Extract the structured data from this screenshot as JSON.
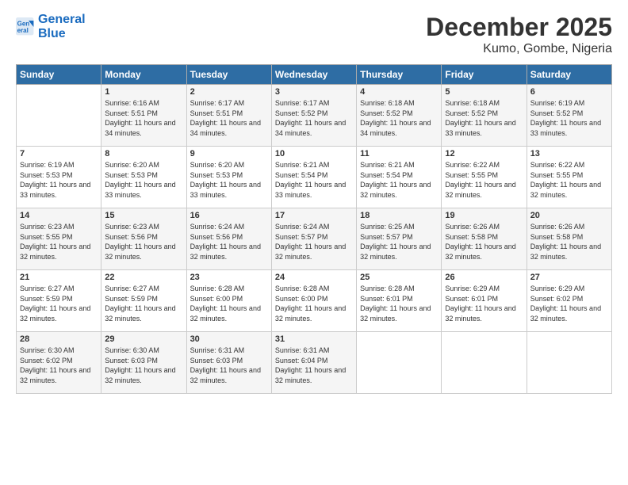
{
  "logo": {
    "line1": "General",
    "line2": "Blue"
  },
  "title": "December 2025",
  "location": "Kumo, Gombe, Nigeria",
  "weekdays": [
    "Sunday",
    "Monday",
    "Tuesday",
    "Wednesday",
    "Thursday",
    "Friday",
    "Saturday"
  ],
  "weeks": [
    [
      {
        "day": "",
        "sunrise": "",
        "sunset": "",
        "daylight": ""
      },
      {
        "day": "1",
        "sunrise": "Sunrise: 6:16 AM",
        "sunset": "Sunset: 5:51 PM",
        "daylight": "Daylight: 11 hours and 34 minutes."
      },
      {
        "day": "2",
        "sunrise": "Sunrise: 6:17 AM",
        "sunset": "Sunset: 5:51 PM",
        "daylight": "Daylight: 11 hours and 34 minutes."
      },
      {
        "day": "3",
        "sunrise": "Sunrise: 6:17 AM",
        "sunset": "Sunset: 5:52 PM",
        "daylight": "Daylight: 11 hours and 34 minutes."
      },
      {
        "day": "4",
        "sunrise": "Sunrise: 6:18 AM",
        "sunset": "Sunset: 5:52 PM",
        "daylight": "Daylight: 11 hours and 34 minutes."
      },
      {
        "day": "5",
        "sunrise": "Sunrise: 6:18 AM",
        "sunset": "Sunset: 5:52 PM",
        "daylight": "Daylight: 11 hours and 33 minutes."
      },
      {
        "day": "6",
        "sunrise": "Sunrise: 6:19 AM",
        "sunset": "Sunset: 5:52 PM",
        "daylight": "Daylight: 11 hours and 33 minutes."
      }
    ],
    [
      {
        "day": "7",
        "sunrise": "Sunrise: 6:19 AM",
        "sunset": "Sunset: 5:53 PM",
        "daylight": "Daylight: 11 hours and 33 minutes."
      },
      {
        "day": "8",
        "sunrise": "Sunrise: 6:20 AM",
        "sunset": "Sunset: 5:53 PM",
        "daylight": "Daylight: 11 hours and 33 minutes."
      },
      {
        "day": "9",
        "sunrise": "Sunrise: 6:20 AM",
        "sunset": "Sunset: 5:53 PM",
        "daylight": "Daylight: 11 hours and 33 minutes."
      },
      {
        "day": "10",
        "sunrise": "Sunrise: 6:21 AM",
        "sunset": "Sunset: 5:54 PM",
        "daylight": "Daylight: 11 hours and 33 minutes."
      },
      {
        "day": "11",
        "sunrise": "Sunrise: 6:21 AM",
        "sunset": "Sunset: 5:54 PM",
        "daylight": "Daylight: 11 hours and 32 minutes."
      },
      {
        "day": "12",
        "sunrise": "Sunrise: 6:22 AM",
        "sunset": "Sunset: 5:55 PM",
        "daylight": "Daylight: 11 hours and 32 minutes."
      },
      {
        "day": "13",
        "sunrise": "Sunrise: 6:22 AM",
        "sunset": "Sunset: 5:55 PM",
        "daylight": "Daylight: 11 hours and 32 minutes."
      }
    ],
    [
      {
        "day": "14",
        "sunrise": "Sunrise: 6:23 AM",
        "sunset": "Sunset: 5:55 PM",
        "daylight": "Daylight: 11 hours and 32 minutes."
      },
      {
        "day": "15",
        "sunrise": "Sunrise: 6:23 AM",
        "sunset": "Sunset: 5:56 PM",
        "daylight": "Daylight: 11 hours and 32 minutes."
      },
      {
        "day": "16",
        "sunrise": "Sunrise: 6:24 AM",
        "sunset": "Sunset: 5:56 PM",
        "daylight": "Daylight: 11 hours and 32 minutes."
      },
      {
        "day": "17",
        "sunrise": "Sunrise: 6:24 AM",
        "sunset": "Sunset: 5:57 PM",
        "daylight": "Daylight: 11 hours and 32 minutes."
      },
      {
        "day": "18",
        "sunrise": "Sunrise: 6:25 AM",
        "sunset": "Sunset: 5:57 PM",
        "daylight": "Daylight: 11 hours and 32 minutes."
      },
      {
        "day": "19",
        "sunrise": "Sunrise: 6:26 AM",
        "sunset": "Sunset: 5:58 PM",
        "daylight": "Daylight: 11 hours and 32 minutes."
      },
      {
        "day": "20",
        "sunrise": "Sunrise: 6:26 AM",
        "sunset": "Sunset: 5:58 PM",
        "daylight": "Daylight: 11 hours and 32 minutes."
      }
    ],
    [
      {
        "day": "21",
        "sunrise": "Sunrise: 6:27 AM",
        "sunset": "Sunset: 5:59 PM",
        "daylight": "Daylight: 11 hours and 32 minutes."
      },
      {
        "day": "22",
        "sunrise": "Sunrise: 6:27 AM",
        "sunset": "Sunset: 5:59 PM",
        "daylight": "Daylight: 11 hours and 32 minutes."
      },
      {
        "day": "23",
        "sunrise": "Sunrise: 6:28 AM",
        "sunset": "Sunset: 6:00 PM",
        "daylight": "Daylight: 11 hours and 32 minutes."
      },
      {
        "day": "24",
        "sunrise": "Sunrise: 6:28 AM",
        "sunset": "Sunset: 6:00 PM",
        "daylight": "Daylight: 11 hours and 32 minutes."
      },
      {
        "day": "25",
        "sunrise": "Sunrise: 6:28 AM",
        "sunset": "Sunset: 6:01 PM",
        "daylight": "Daylight: 11 hours and 32 minutes."
      },
      {
        "day": "26",
        "sunrise": "Sunrise: 6:29 AM",
        "sunset": "Sunset: 6:01 PM",
        "daylight": "Daylight: 11 hours and 32 minutes."
      },
      {
        "day": "27",
        "sunrise": "Sunrise: 6:29 AM",
        "sunset": "Sunset: 6:02 PM",
        "daylight": "Daylight: 11 hours and 32 minutes."
      }
    ],
    [
      {
        "day": "28",
        "sunrise": "Sunrise: 6:30 AM",
        "sunset": "Sunset: 6:02 PM",
        "daylight": "Daylight: 11 hours and 32 minutes."
      },
      {
        "day": "29",
        "sunrise": "Sunrise: 6:30 AM",
        "sunset": "Sunset: 6:03 PM",
        "daylight": "Daylight: 11 hours and 32 minutes."
      },
      {
        "day": "30",
        "sunrise": "Sunrise: 6:31 AM",
        "sunset": "Sunset: 6:03 PM",
        "daylight": "Daylight: 11 hours and 32 minutes."
      },
      {
        "day": "31",
        "sunrise": "Sunrise: 6:31 AM",
        "sunset": "Sunset: 6:04 PM",
        "daylight": "Daylight: 11 hours and 32 minutes."
      },
      {
        "day": "",
        "sunrise": "",
        "sunset": "",
        "daylight": ""
      },
      {
        "day": "",
        "sunrise": "",
        "sunset": "",
        "daylight": ""
      },
      {
        "day": "",
        "sunrise": "",
        "sunset": "",
        "daylight": ""
      }
    ]
  ]
}
